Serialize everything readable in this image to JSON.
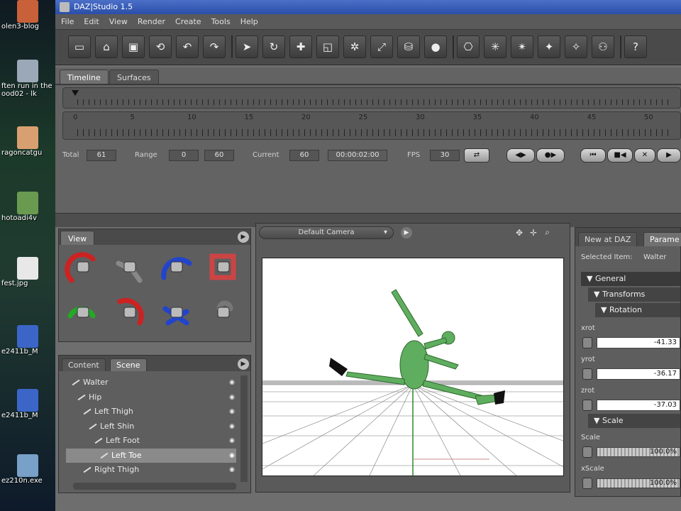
{
  "desktop": {
    "icons": [
      {
        "label": "olen3-blog",
        "color": "#c8603a"
      },
      {
        "label": "ften run in the",
        "label2": "ood02 - lk",
        "color": "#9aa8b8"
      },
      {
        "label": "ragoncatgu",
        "color": "#d8a070"
      },
      {
        "label": "hotoadi4v",
        "color": "#6a9a50"
      },
      {
        "label": "fest.jpg",
        "color": "#e8e8e8"
      },
      {
        "label": "e2411b_M",
        "color": "#3b66c8"
      },
      {
        "label": "e2411b_M",
        "color": "#3b66c8"
      },
      {
        "label": "ez210n.exe",
        "color": "#78a0c8"
      }
    ]
  },
  "window": {
    "title": "DAZ|Studio 1.5"
  },
  "menu": [
    "File",
    "Edit",
    "View",
    "Render",
    "Create",
    "Tools",
    "Help"
  ],
  "toolbar": {
    "buttons": [
      "new-icon",
      "open-icon",
      "save-icon",
      "merge-icon",
      "undo-icon",
      "redo-icon",
      "select-icon",
      "rotate-icon",
      "translate-icon",
      "scale-icon",
      "node-select-icon",
      "bone-icon",
      "render-icon",
      "sphere-icon",
      "camera-add-icon",
      "light-add-icon",
      "spot-light-icon",
      "point-light-icon",
      "distant-light-icon",
      "figure-add-icon",
      "help-icon"
    ],
    "glyphs": [
      "▭",
      "⌂",
      "▣",
      "⟲",
      "↶",
      "↷",
      "➤",
      "↻",
      "✚",
      "◱",
      "✲",
      "⤢",
      "⛁",
      "●",
      "⎔",
      "✳",
      "✴",
      "✦",
      "✧",
      "⚇",
      "?"
    ]
  },
  "timeline": {
    "tabs": [
      "Timeline",
      "Surfaces"
    ],
    "tick_labels": [
      "0",
      "5",
      "10",
      "15",
      "20",
      "25",
      "30",
      "35",
      "40",
      "45",
      "50"
    ],
    "total_label": "Total",
    "total": "61",
    "range_label": "Range",
    "range_start": "0",
    "range_end": "60",
    "current_label": "Current",
    "current": "60",
    "timecode": "00:00:02:00",
    "fps_label": "FPS",
    "fps": "30"
  },
  "view_panel": {
    "tab": "View"
  },
  "scene_panel": {
    "tabs": [
      "Content",
      "Scene"
    ],
    "items": [
      {
        "label": "Walter",
        "indent": 0
      },
      {
        "label": "Hip",
        "indent": 1
      },
      {
        "label": "Left Thigh",
        "indent": 2
      },
      {
        "label": "Left Shin",
        "indent": 3
      },
      {
        "label": "Left Foot",
        "indent": 4
      },
      {
        "label": "Left Toe",
        "indent": 5,
        "selected": true
      },
      {
        "label": "Right Thigh",
        "indent": 2
      }
    ]
  },
  "viewport": {
    "camera": "Default Camera"
  },
  "params": {
    "tabs": [
      "New at DAZ",
      "Parame"
    ],
    "selected_label": "Selected Item:",
    "selected_value": "Walter",
    "sections": [
      "General",
      "Transforms",
      "Rotation",
      "Scale"
    ],
    "xrot_label": "xrot",
    "xrot": "-41.33",
    "yrot_label": "yrot",
    "yrot": "-36.17",
    "zrot_label": "zrot",
    "zrot": "-37.03",
    "scale_label": "Scale",
    "scale": "100.0%",
    "xscale_label": "xScale",
    "xscale": "100.0%"
  }
}
